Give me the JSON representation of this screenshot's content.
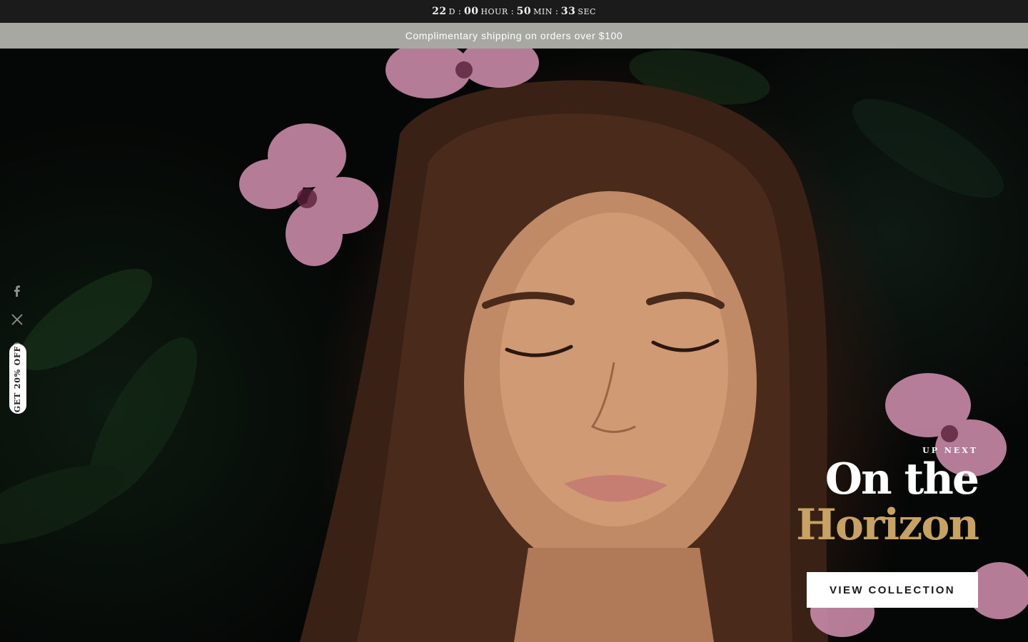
{
  "countdown": {
    "days": "22",
    "days_unit": "D",
    "hours": "00",
    "hours_unit": "HOUR",
    "minutes": "50",
    "minutes_unit": "MIN",
    "seconds": "33",
    "seconds_unit": "SEC",
    "separator": ":"
  },
  "announcement": {
    "text": "Complimentary shipping on orders over $100"
  },
  "social": [
    {
      "name": "facebook-icon"
    },
    {
      "name": "x-twitter-icon"
    },
    {
      "name": "pinterest-icon"
    },
    {
      "name": "reddit-icon"
    }
  ],
  "discount_tab": {
    "label": "GET 20% OFF"
  },
  "hero": {
    "eyebrow": "UP NEXT",
    "headline_line1": "On the",
    "headline_line2": "Horizon",
    "cta_label": "VIEW COLLECTION"
  },
  "colors": {
    "countdown_bg": "#1b1b1b",
    "announcement_bg": "#a8a8a3",
    "accent_gold": "#c8a263",
    "cta_bg": "#ffffff"
  }
}
